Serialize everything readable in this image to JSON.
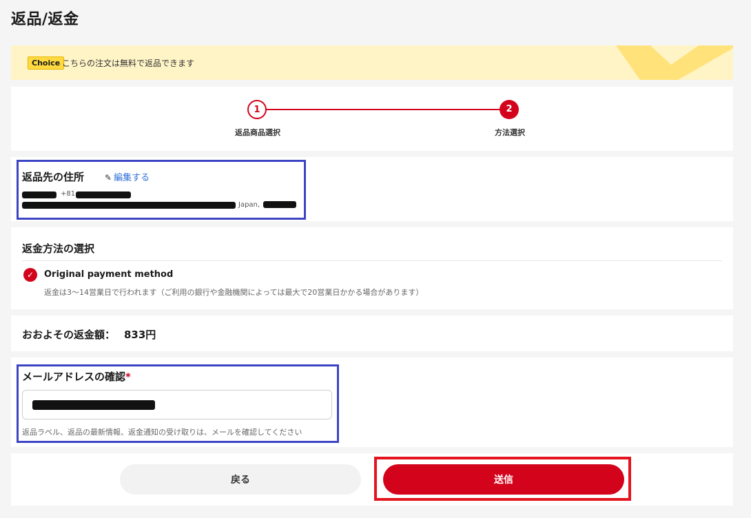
{
  "page": {
    "title": "返品/返金"
  },
  "banner": {
    "badge": "Choice",
    "text": "こちらの注文は無料で返品できます"
  },
  "steps": [
    {
      "number": "1",
      "label": "返品商品選択"
    },
    {
      "number": "2",
      "label": "方法選択"
    }
  ],
  "address": {
    "title": "返品先の住所",
    "edit_label": "編集する",
    "phone_prefix": "+81",
    "country": "Japan,"
  },
  "refund_method": {
    "title": "返金方法の選択",
    "selected_label": "Original payment method",
    "note": "返金は3〜14営業日で行われます（ご利用の銀行や金融機関によっては最大で20営業日かかる場合があります）"
  },
  "amount": {
    "label": "おおよその返金額：",
    "value": "833円"
  },
  "email": {
    "title": "メールアドレスの確認",
    "required_mark": "*",
    "hint": "返品ラベル、返品の最新情報、返金通知の受け取りは、メールを確認してください"
  },
  "actions": {
    "back_label": "戻る",
    "submit_label": "送信"
  },
  "colors": {
    "accent": "#d3031c",
    "highlight_box": "#3c44c4",
    "banner_bg": "#fff4c6",
    "link": "#2e6fd6"
  }
}
